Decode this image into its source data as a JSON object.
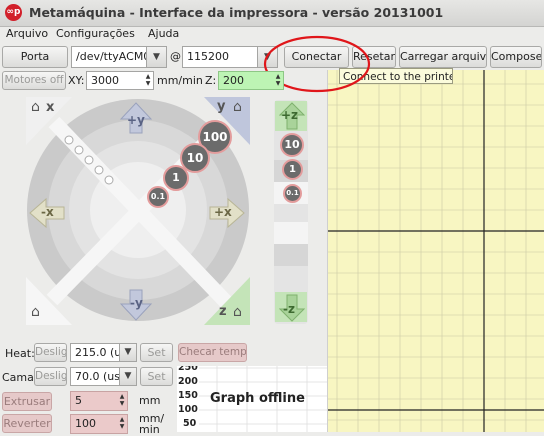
{
  "window": {
    "title": "Metamáquina - Interface da impressora - versão 20131001",
    "app_icon": "∞p"
  },
  "menu": [
    "Arquivo",
    "Configurações",
    "Ajuda"
  ],
  "connection": {
    "port_button": "Porta",
    "port_value": "/dev/ttyACM0",
    "at_symbol": "@",
    "baud_value": "115200",
    "connect_button": "Conectar",
    "reset_button": "Resetar",
    "load_file_button": "Carregar arquivo",
    "compose_button": "Compose",
    "tooltip": "Connect to the printer"
  },
  "motion": {
    "motors_off_button": "Motores off",
    "xy_label": "XY:",
    "xy_speed": "3000",
    "xy_unit": "mm/min",
    "z_label": "Z:",
    "z_speed": "200"
  },
  "jog": {
    "x_home": "x",
    "y_home": "y",
    "z_home": "z",
    "plus_y": "+y",
    "minus_y": "-y",
    "minus_x": "-x",
    "plus_x": "+x",
    "steps": [
      "100",
      "10",
      "1",
      "0.1"
    ],
    "z_plus": "+z",
    "z_minus": "-z",
    "z_steps": [
      "10",
      "1",
      "0.1"
    ]
  },
  "temperature": {
    "heat_label": "Heat:",
    "heat_off": "Deslig",
    "heat_value": "215.0 (u",
    "set_button": "Set",
    "check_temp_button": "Checar temp",
    "bed_label": "Cama:",
    "bed_off": "Deslig",
    "bed_value": "70.0 (us",
    "bed_set_button": "Set"
  },
  "extrude": {
    "extrude_button": "Extrusar",
    "extrude_amount": "5",
    "extrude_unit": "mm",
    "reverse_button": "Reverter",
    "feed_rate": "100",
    "feed_unit": "mm/\nmin"
  },
  "graph": {
    "status": "Graph offline",
    "y_ticks": [
      "250",
      "200",
      "150",
      "100",
      "50"
    ]
  },
  "colors": {
    "grid_bg": "#f8f6c2",
    "step_circle": "#6b6b6b",
    "step_ring": "#e39c9c",
    "z_green": "#c4e4b8",
    "highlight": "#e0161a"
  }
}
